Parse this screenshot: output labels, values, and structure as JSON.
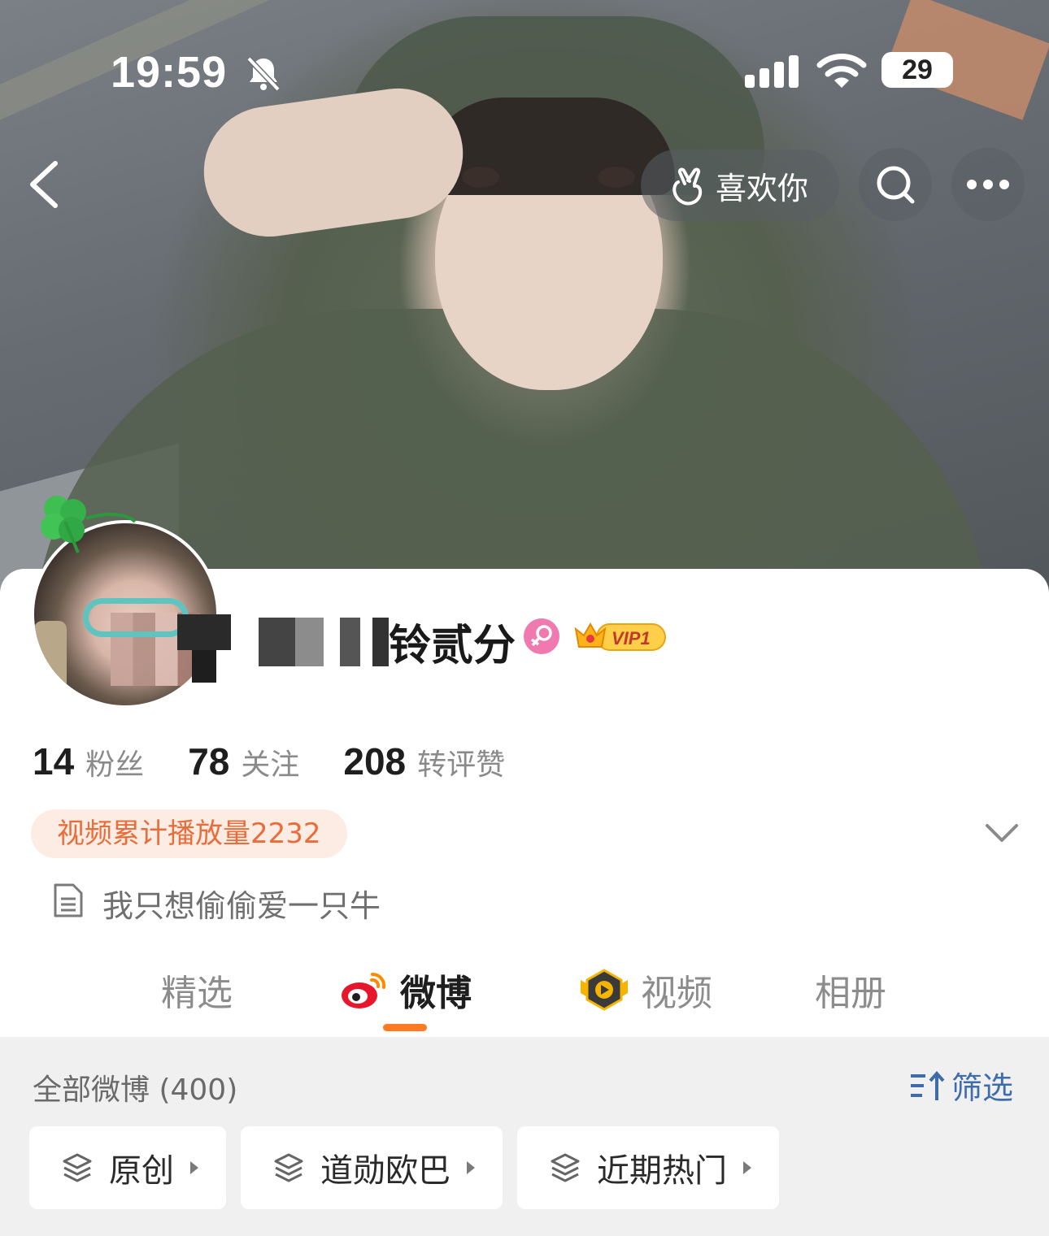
{
  "status_bar": {
    "time": "19:59",
    "battery": "29"
  },
  "header": {
    "like_label": "喜欢你"
  },
  "profile": {
    "username_visible": "铃贰分",
    "vip_label": "VIP1",
    "stats": [
      {
        "value": "14",
        "label": "粉丝"
      },
      {
        "value": "78",
        "label": "关注"
      },
      {
        "value": "208",
        "label": "转评赞"
      }
    ],
    "play_count": "视频累计播放量2232",
    "bio": "我只想偷偷爱一只牛"
  },
  "tabs": [
    {
      "label": "精选",
      "active": false
    },
    {
      "label": "微博",
      "active": true
    },
    {
      "label": "视频",
      "active": false
    },
    {
      "label": "相册",
      "active": false
    }
  ],
  "feed": {
    "title": "全部微博 (400)",
    "filter_label": "筛选",
    "chips": [
      {
        "label": "原创"
      },
      {
        "label": "道勋欧巴"
      },
      {
        "label": "近期热门"
      }
    ]
  },
  "colors": {
    "accent_orange": "#ff7a22",
    "link_blue": "#3f6dab",
    "play_pill_text": "#e96d3a",
    "female_pink": "#f07ab0"
  }
}
